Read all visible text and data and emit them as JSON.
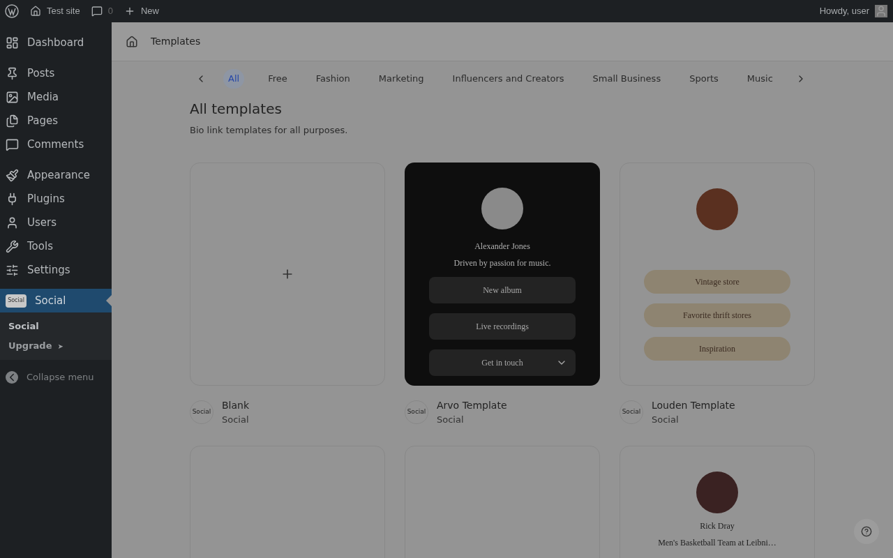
{
  "admin_bar": {
    "site": "Test site",
    "comments": "0",
    "new": "New",
    "greeting": "Howdy, user"
  },
  "sidebar": {
    "groups": [
      [
        {
          "kind": "dashboard",
          "label": "Dashboard",
          "selected": false
        }
      ],
      [
        {
          "kind": "pin",
          "label": "Posts",
          "selected": false
        },
        {
          "kind": "media",
          "label": "Media",
          "selected": false
        },
        {
          "kind": "pages",
          "label": "Pages",
          "selected": false
        },
        {
          "kind": "comments",
          "label": "Comments",
          "selected": false
        }
      ],
      [
        {
          "kind": "brush",
          "label": "Appearance",
          "selected": false
        },
        {
          "kind": "plug",
          "label": "Plugins",
          "selected": false
        },
        {
          "kind": "user",
          "label": "Users",
          "selected": false
        },
        {
          "kind": "wrench",
          "label": "Tools",
          "selected": false
        },
        {
          "kind": "sliders",
          "label": "Settings",
          "selected": false
        }
      ],
      [
        {
          "kind": "logo",
          "label": "Social",
          "logo": "Social",
          "selected": true
        }
      ]
    ],
    "submenu": [
      {
        "label": "Social",
        "selected": true
      },
      {
        "label": "Upgrade",
        "arrow": "➤",
        "selected": false
      }
    ],
    "collapse": "Collapse menu"
  },
  "header": {
    "title": "Templates"
  },
  "tabs": [
    {
      "label": "All",
      "selected": true
    },
    {
      "label": "Free",
      "selected": false
    },
    {
      "label": "Fashion",
      "selected": false
    },
    {
      "label": "Marketing",
      "selected": false
    },
    {
      "label": "Influencers and Creators",
      "selected": false
    },
    {
      "label": "Small Business",
      "selected": false
    },
    {
      "label": "Sports",
      "selected": false
    },
    {
      "label": "Music",
      "selected": false
    }
  ],
  "heading": "All templates",
  "subtitle": "Bio link templates for all purposes.",
  "templates": [
    {
      "kind": "blank",
      "name": "Blank",
      "category": "Social",
      "badge": "Social"
    },
    {
      "kind": "dark",
      "name": "Arvo Template",
      "category": "Social",
      "badge": "Social",
      "profile_name": "Alexander Jones",
      "bio": "Driven by passion for music.",
      "links": [
        {
          "label": "New album",
          "dropdown": false
        },
        {
          "label": "Live recordings",
          "dropdown": false
        },
        {
          "label": "Get in touch",
          "dropdown": true
        }
      ]
    },
    {
      "kind": "light",
      "name": "Louden Template",
      "category": "Social",
      "badge": "Social",
      "links": [
        {
          "label": "Vintage store"
        },
        {
          "label": "Favorite thrift stores"
        },
        {
          "label": "Inspiration"
        }
      ]
    },
    {
      "kind": "red"
    },
    {
      "kind": "empty"
    },
    {
      "kind": "profile",
      "profile_name": "Rick Dray",
      "bio": "Men's Basketball Team at Leibni…"
    }
  ]
}
